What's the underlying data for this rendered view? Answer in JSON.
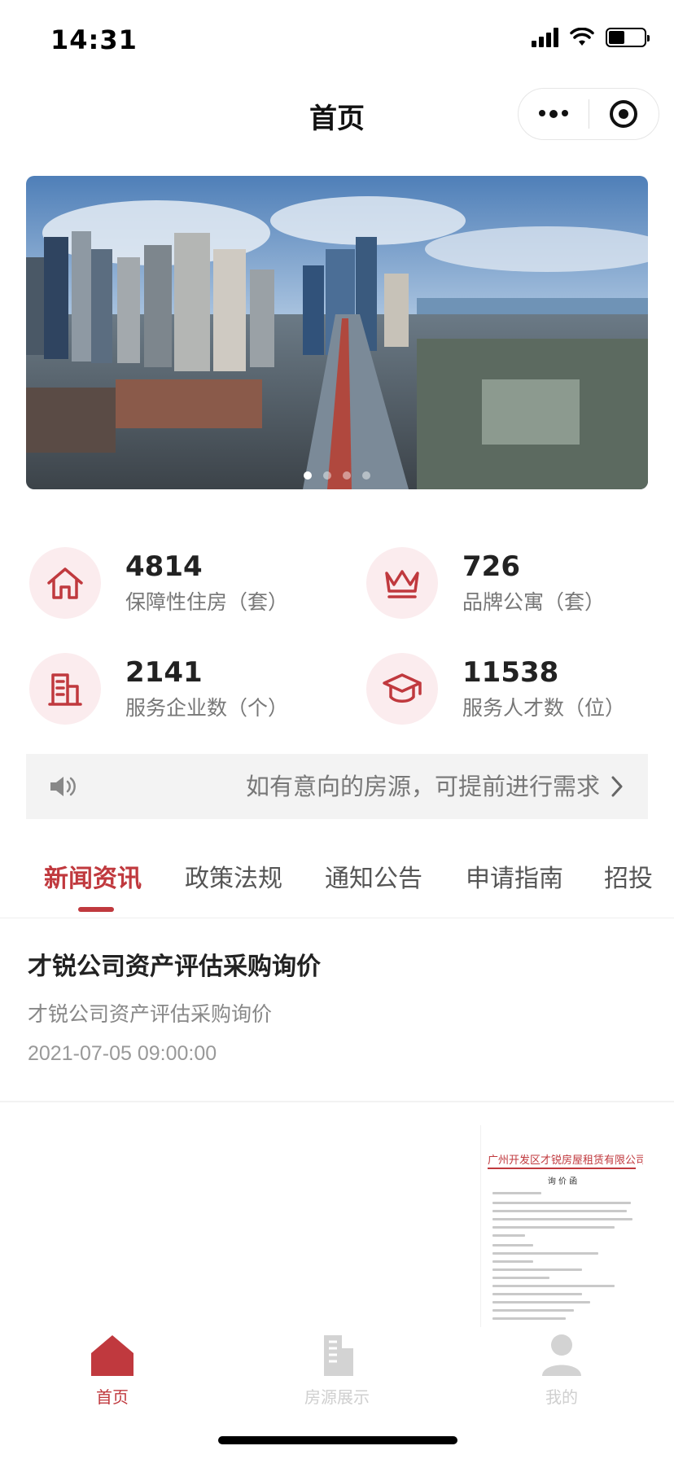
{
  "status": {
    "time": "14:31"
  },
  "nav": {
    "title": "首页"
  },
  "banner": {
    "slide_count": 4,
    "active_index": 0
  },
  "stats": [
    {
      "icon": "house-icon",
      "value": "4814",
      "label": "保障性住房（套）"
    },
    {
      "icon": "crown-icon",
      "value": "726",
      "label": "品牌公寓（套）"
    },
    {
      "icon": "building-icon",
      "value": "2141",
      "label": "服务企业数（个）"
    },
    {
      "icon": "graduation-cap-icon",
      "value": "11538",
      "label": "服务人才数（位）"
    }
  ],
  "notice": {
    "text": "如有意向的房源，可提前进行需求"
  },
  "tabs": [
    {
      "label": "新闻资讯",
      "active": true
    },
    {
      "label": "政策法规",
      "active": false
    },
    {
      "label": "通知公告",
      "active": false
    },
    {
      "label": "申请指南",
      "active": false
    },
    {
      "label": "招投",
      "active": false
    }
  ],
  "news": [
    {
      "title": "才锐公司资产评估采购询价",
      "summary": "才锐公司资产评估采购询价",
      "date": "2021-07-05 09:00:00"
    }
  ],
  "doc_preview": {
    "company": "广州开发区才锐房屋租赁有限公司",
    "heading": "询 价 函"
  },
  "tabbar": [
    {
      "label": "首页",
      "icon": "home-icon",
      "active": true
    },
    {
      "label": "房源展示",
      "icon": "building-icon",
      "active": false
    },
    {
      "label": "我的",
      "icon": "user-icon",
      "active": false
    }
  ],
  "colors": {
    "accent": "#c0393e",
    "icon_bg": "#fbecee"
  }
}
